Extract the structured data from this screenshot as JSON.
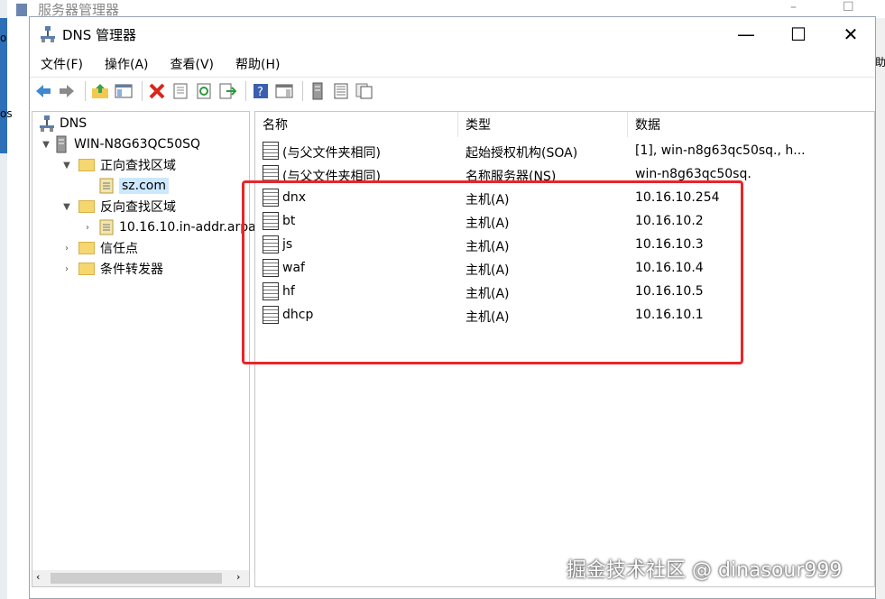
{
  "background_window": {
    "title": "服务器管理器",
    "minimize": "–",
    "maximize": "☐",
    "sidebar_text": "o",
    "sidebar_text2": "os",
    "right_text": "助"
  },
  "window": {
    "title": "DNS 管理器",
    "minimize": "—",
    "maximize": "☐",
    "close": "✕"
  },
  "menu": [
    "文件(F)",
    "操作(A)",
    "查看(V)",
    "帮助(H)"
  ],
  "toolbar": [
    "back-icon",
    "forward-icon",
    "up-folder-icon",
    "show-tree-icon",
    "delete-icon",
    "properties-icon",
    "refresh-icon",
    "export-icon",
    "help-icon",
    "console-icon",
    "server-icon",
    "list-icon",
    "copy-icon"
  ],
  "tree": {
    "root": "DNS",
    "server": "WIN-N8G63QC50SQ",
    "forward_zone": "正向查找区域",
    "zone": "sz.com",
    "reverse_zone": "反向查找区域",
    "reverse_entry": "10.16.10.in-addr.arpa",
    "trust_points": "信任点",
    "forwarders": "条件转发器"
  },
  "list": {
    "columns": [
      "名称",
      "类型",
      "数据"
    ],
    "rows": [
      [
        "(与父文件夹相同)",
        "起始授权机构(SOA)",
        "[1], win-n8g63qc50sq., h..."
      ],
      [
        "(与父文件夹相同)",
        "名称服务器(NS)",
        "win-n8g63qc50sq."
      ],
      [
        "dnx",
        "主机(A)",
        "10.16.10.254"
      ],
      [
        "bt",
        "主机(A)",
        "10.16.10.2"
      ],
      [
        "js",
        "主机(A)",
        "10.16.10.3"
      ],
      [
        "waf",
        "主机(A)",
        "10.16.10.4"
      ],
      [
        "hf",
        "主机(A)",
        "10.16.10.5"
      ],
      [
        "dhcp",
        "主机(A)",
        "10.16.10.1"
      ]
    ]
  },
  "watermark": "掘金技术社区 @ dinasour999",
  "colors": {
    "highlight": "#e8262a",
    "selection": "#cce8ff"
  }
}
